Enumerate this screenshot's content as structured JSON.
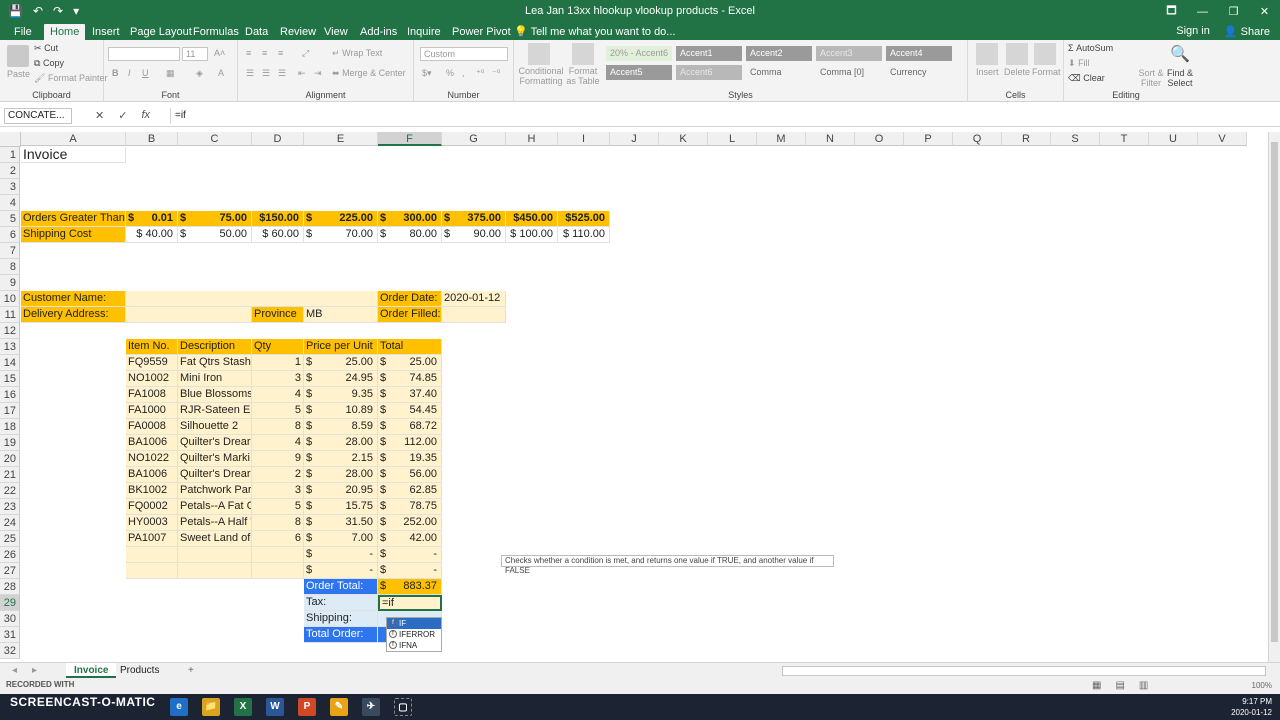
{
  "window": {
    "title": "Lea Jan 13xx hlookup vlookup products - Excel",
    "controls": [
      "🗖",
      "—",
      "❐",
      "✕"
    ]
  },
  "ribbon_tabs": [
    "File",
    "Home",
    "Insert",
    "Page Layout",
    "Formulas",
    "Data",
    "Review",
    "View",
    "Add-ins",
    "Inquire",
    "Power Pivot"
  ],
  "tell_me": "Tell me what you want to do...",
  "account": {
    "sign_in": "Sign in",
    "share": "Share"
  },
  "ribbon": {
    "clipboard": {
      "label": "Clipboard",
      "paste": "Paste",
      "cut": "Cut",
      "copy": "Copy",
      "format_painter": "Format Painter"
    },
    "font": {
      "label": "Font",
      "size": "11"
    },
    "alignment": {
      "label": "Alignment",
      "wrap": "Wrap Text",
      "merge": "Merge & Center"
    },
    "number": {
      "label": "Number",
      "format": "Custom",
      "pct": "%",
      "comma": ","
    },
    "styles": {
      "label": "Styles",
      "cond": "Conditional Formatting",
      "as_table": "Format as Table",
      "chips": [
        {
          "text": "20% - Accent6",
          "bg": "#e2efda",
          "fg": "#9a9a9a"
        },
        {
          "text": "Accent1",
          "bg": "#9a9a9a",
          "fg": "#ffffff"
        },
        {
          "text": "Accent2",
          "bg": "#9a9a9a",
          "fg": "#ffffff"
        },
        {
          "text": "Accent3",
          "bg": "#b8b8b8",
          "fg": "#e8e8e8"
        },
        {
          "text": "Accent4",
          "bg": "#9a9a9a",
          "fg": "#ffffff"
        },
        {
          "text": "Accent5",
          "bg": "#9a9a9a",
          "fg": "#ffffff"
        },
        {
          "text": "Accent6",
          "bg": "#b8b8b8",
          "fg": "#e8e8e8"
        },
        {
          "text": "Comma",
          "bg": "#f3f3f3",
          "fg": "#666666"
        },
        {
          "text": "Comma [0]",
          "bg": "#f3f3f3",
          "fg": "#666666"
        },
        {
          "text": "Currency",
          "bg": "#f3f3f3",
          "fg": "#666666"
        }
      ]
    },
    "cells": {
      "label": "Cells",
      "insert": "Insert",
      "delete": "Delete",
      "format": "Format"
    },
    "editing": {
      "label": "Editing",
      "autosum": "AutoSum",
      "fill": "Fill",
      "clear": "Clear",
      "sort": "Sort & Filter",
      "find": "Find & Select"
    }
  },
  "formula_bar": {
    "name_box": "CONCATE...",
    "cancel": "✕",
    "enter": "✓",
    "fx": "fx",
    "formula": "=if"
  },
  "columns": [
    "A",
    "B",
    "C",
    "D",
    "E",
    "F",
    "G",
    "H",
    "I",
    "J",
    "K",
    "L",
    "M",
    "N",
    "O",
    "P",
    "Q",
    "R",
    "S",
    "T",
    "U",
    "V"
  ],
  "rows": [
    "1",
    "2",
    "3",
    "4",
    "5",
    "6",
    "7",
    "8",
    "9",
    "10",
    "11",
    "12",
    "13",
    "14",
    "15",
    "16",
    "17",
    "18",
    "19",
    "20",
    "21",
    "22",
    "23",
    "24",
    "25",
    "26",
    "27",
    "28",
    "29",
    "30",
    "31",
    "32"
  ],
  "sheet": {
    "title": "Invoice",
    "shipping_table": {
      "row5_label": "Orders Greater Than",
      "row6_label": "Shipping Cost",
      "row5": [
        {
          "acc": "$",
          "amt": "0.01"
        },
        {
          "acc": "$",
          "amt": "75.00"
        },
        {
          "acc": "",
          "amt": "$150.00"
        },
        {
          "acc": "$",
          "amt": "225.00"
        },
        {
          "acc": "$",
          "amt": "300.00"
        },
        {
          "acc": "$",
          "amt": "375.00"
        },
        {
          "acc": "",
          "amt": "$450.00"
        },
        {
          "acc": "",
          "amt": "$525.00"
        }
      ],
      "row6": [
        {
          "acc": "",
          "amt": "$ 40.00"
        },
        {
          "acc": "$",
          "amt": "50.00"
        },
        {
          "acc": "",
          "amt": "$ 60.00"
        },
        {
          "acc": "$",
          "amt": "70.00"
        },
        {
          "acc": "$",
          "amt": "80.00"
        },
        {
          "acc": "$",
          "amt": "90.00"
        },
        {
          "acc": "",
          "amt": "$ 100.00"
        },
        {
          "acc": "",
          "amt": "$ 110.00"
        }
      ]
    },
    "customer_name_label": "Customer Name:",
    "delivery_address_label": "Delivery Address:",
    "province_label": "Province",
    "province_value": "MB",
    "order_date_label": "Order Date:",
    "order_date_value": "2020-01-12",
    "order_filled_label": "Order Filled:",
    "item_headers": [
      "Item No.",
      "Description",
      "Qty",
      "Price per Unit",
      "Total"
    ],
    "items": [
      {
        "item": "FQ9559",
        "desc": "Fat Qtrs Stash",
        "qty": "1",
        "price": "25.00",
        "total": "25.00"
      },
      {
        "item": "NO1002",
        "desc": "Mini Iron",
        "qty": "3",
        "price": "24.95",
        "total": "74.85"
      },
      {
        "item": "FA1008",
        "desc": "Blue Blossoms",
        "qty": "4",
        "price": "9.35",
        "total": "37.40"
      },
      {
        "item": "FA1000",
        "desc": "RJR-Sateen Ele",
        "qty": "5",
        "price": "10.89",
        "total": "54.45"
      },
      {
        "item": "FA0008",
        "desc": "Silhouette 2",
        "qty": "8",
        "price": "8.59",
        "total": "68.72"
      },
      {
        "item": "BA1006",
        "desc": "Quilter's Drear",
        "qty": "4",
        "price": "28.00",
        "total": "112.00"
      },
      {
        "item": "NO1022",
        "desc": "Quilter's Marki",
        "qty": "9",
        "price": "2.15",
        "total": "19.35"
      },
      {
        "item": "BA1006",
        "desc": "Quilter's Drear",
        "qty": "2",
        "price": "28.00",
        "total": "56.00"
      },
      {
        "item": "BK1002",
        "desc": "Patchwork Par",
        "qty": "3",
        "price": "20.95",
        "total": "62.85"
      },
      {
        "item": "FQ0002",
        "desc": "Petals--A Fat C",
        "qty": "5",
        "price": "15.75",
        "total": "78.75"
      },
      {
        "item": "HY0003",
        "desc": "Petals--A Half '",
        "qty": "8",
        "price": "31.50",
        "total": "252.00"
      },
      {
        "item": "PA1007",
        "desc": "Sweet Land of",
        "qty": "6",
        "price": "7.00",
        "total": "42.00"
      },
      {
        "item": "",
        "desc": "",
        "qty": "",
        "price": "-",
        "total": "-"
      },
      {
        "item": "",
        "desc": "",
        "qty": "",
        "price": "-",
        "total": "-"
      }
    ],
    "currency_symbol": "$",
    "order_total_label": "Order Total:",
    "order_total_value": "883.37",
    "tax_label": "Tax:",
    "shipping_label": "Shipping:",
    "total_order_label": "Total Order:",
    "active_cell_text": "=if"
  },
  "tooltip": "Checks whether a condition is met, and returns one value if TRUE, and another value if FALSE",
  "autocomplete": [
    "IF",
    "IFERROR",
    "IFNA"
  ],
  "sheet_tabs": [
    "Invoice",
    "Products"
  ],
  "add_sheet": "+",
  "status": {
    "watermark": "RECORDED WITH",
    "zoom": "100%"
  },
  "taskbar": {
    "brand": "SCREENCAST-O-MATIC",
    "apps": [
      "e",
      "📁",
      "X",
      "W",
      "P",
      "✎",
      "✈",
      "▢"
    ],
    "time": "9:17 PM",
    "date": "2020-01-12"
  },
  "colors": {
    "excel_green": "#217346",
    "orange": "#ffc000",
    "light_yellow": "#fff2cc",
    "light_blue": "#ddebf7",
    "blue": "#2e75f0"
  }
}
